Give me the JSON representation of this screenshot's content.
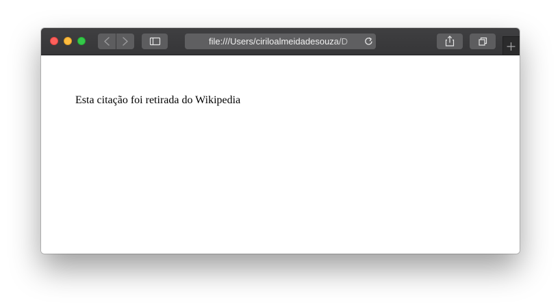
{
  "browser": {
    "address_bar": {
      "url": "file:///Users/ciriloalmeidadesouza/D"
    },
    "icons": {
      "back": "chevron-left-icon",
      "forward": "chevron-right-icon",
      "sidebar": "sidebar-icon",
      "reload": "reload-icon",
      "share": "share-icon",
      "tabs": "tab-overview-icon",
      "new_tab": "plus-icon"
    },
    "colors": {
      "toolbar": "#3b3b3d",
      "button": "#5d5d5f",
      "close": "#fc605c",
      "minimize": "#fdbc40",
      "zoom": "#34c84a"
    }
  },
  "page": {
    "text": "Esta citação foi retirada do Wikipedia"
  }
}
